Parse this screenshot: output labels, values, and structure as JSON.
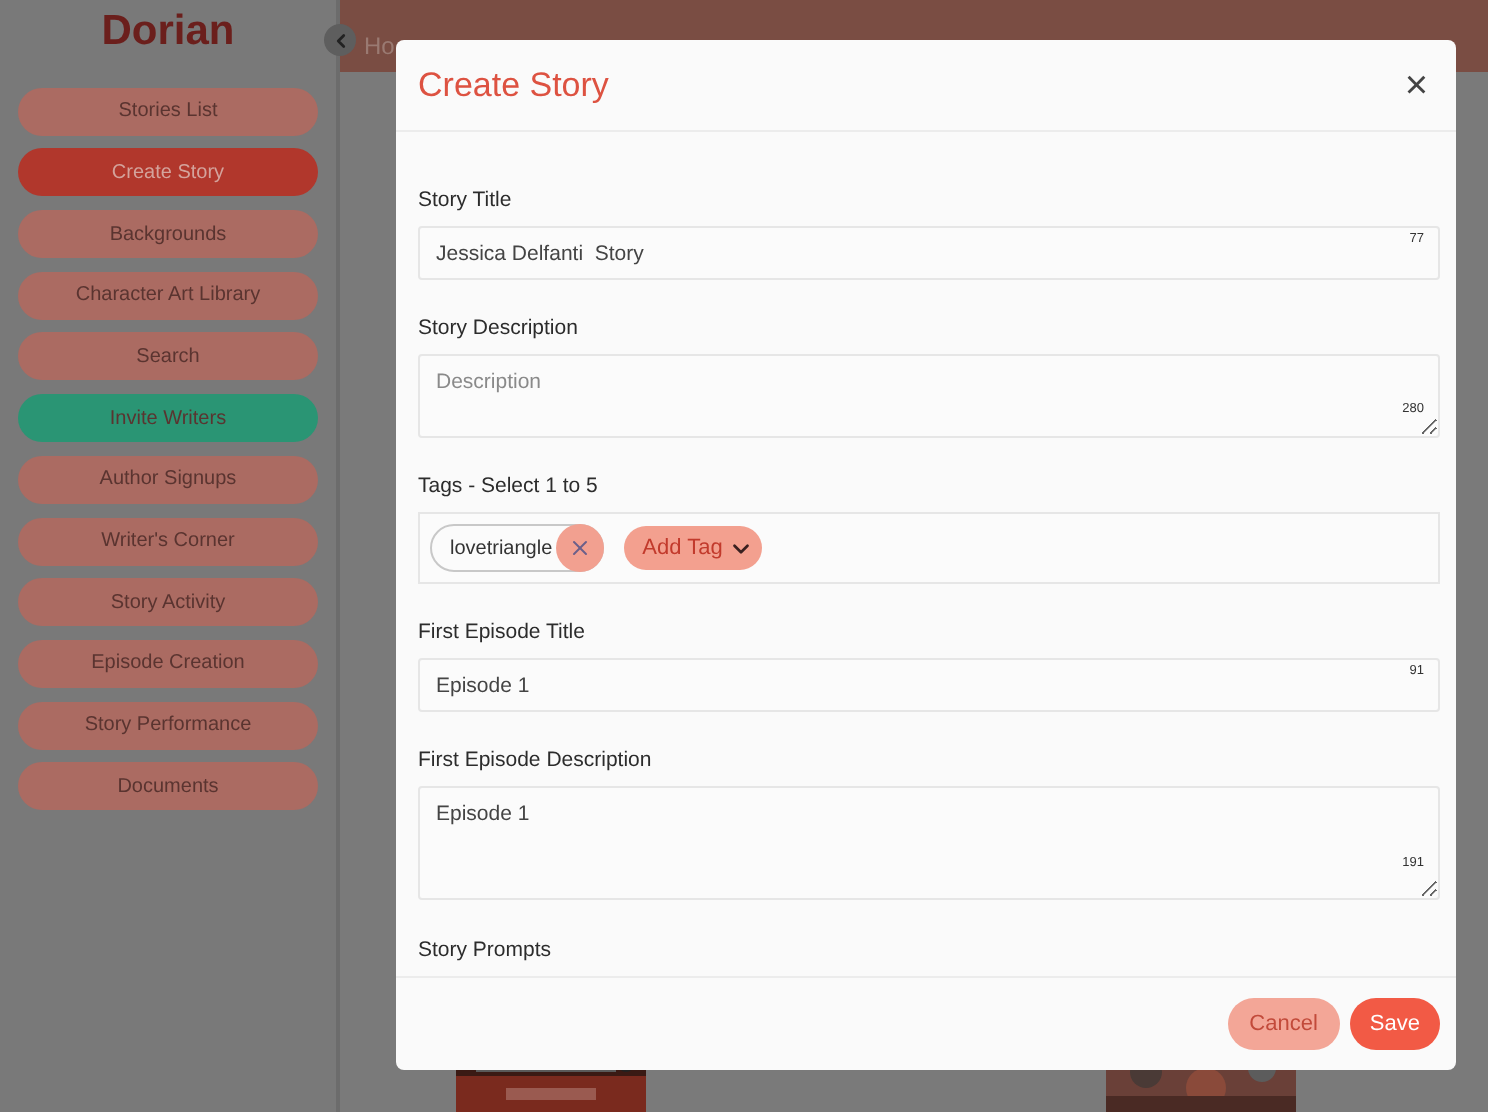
{
  "sidebar": {
    "brand": "Dorian",
    "items": [
      {
        "label": "Stories List",
        "selected": false,
        "highlight": false
      },
      {
        "label": "Create Story",
        "selected": true,
        "highlight": false
      },
      {
        "label": "Backgrounds",
        "selected": false,
        "highlight": false
      },
      {
        "label": "Character Art Library",
        "selected": false,
        "highlight": false
      },
      {
        "label": "Search",
        "selected": false,
        "highlight": false
      },
      {
        "label": "Invite Writers",
        "selected": false,
        "highlight": true
      },
      {
        "label": "Author Signups",
        "selected": false,
        "highlight": false
      },
      {
        "label": "Writer's Corner",
        "selected": false,
        "highlight": false
      },
      {
        "label": "Story Activity",
        "selected": false,
        "highlight": false
      },
      {
        "label": "Episode Creation",
        "selected": false,
        "highlight": false
      },
      {
        "label": "Story Performance",
        "selected": false,
        "highlight": false
      },
      {
        "label": "Documents",
        "selected": false,
        "highlight": false
      }
    ]
  },
  "header": {
    "home_link": "Ho"
  },
  "modal": {
    "title": "Create Story",
    "close": "×",
    "fields": [
      {
        "kind": "text",
        "label": "Story Title",
        "value": "Jessica Delfanti  Story",
        "counter": "77"
      },
      {
        "kind": "textarea",
        "label": "Story Description",
        "placeholder": "Description",
        "counter": "280"
      },
      {
        "kind": "tags",
        "label": "Tags - Select 1 to 5",
        "tags": [
          {
            "label": "lovetriangle"
          }
        ],
        "add_button": "Add Tag"
      },
      {
        "kind": "text",
        "label": "First Episode Title",
        "value": "Episode 1",
        "counter": "91"
      },
      {
        "kind": "textarea",
        "label": "First Episode Description",
        "value": "Episode 1",
        "counter": "191"
      },
      {
        "kind": "section",
        "label": "Story Prompts"
      }
    ],
    "buttons": [
      {
        "label": "Cancel",
        "kind": "secondary"
      },
      {
        "label": "Save",
        "kind": "primary"
      }
    ]
  }
}
